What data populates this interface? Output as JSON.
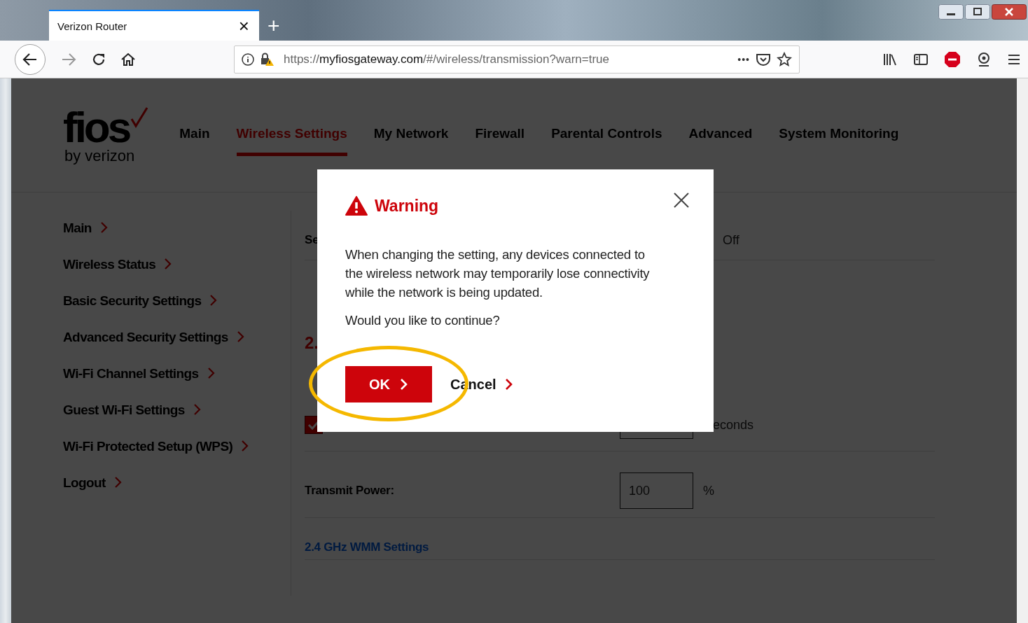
{
  "browser": {
    "tab": {
      "title": "Verizon Router",
      "close": "×"
    },
    "new_tab": "+",
    "url": {
      "scheme": "https://",
      "domain": "myfiosgateway.com",
      "path": "/#/wireless/transmission?warn=true"
    },
    "page_actions": "•••"
  },
  "logo": {
    "wordmark": "fios",
    "tagline": "by verizon"
  },
  "nav": [
    {
      "label": "Main",
      "selected": false
    },
    {
      "label": "Wireless Settings",
      "selected": true
    },
    {
      "label": "My Network",
      "selected": false
    },
    {
      "label": "Firewall",
      "selected": false
    },
    {
      "label": "Parental Controls",
      "selected": false
    },
    {
      "label": "Advanced",
      "selected": false
    },
    {
      "label": "System Monitoring",
      "selected": false
    }
  ],
  "sidebar": {
    "items": [
      {
        "label": "Main"
      },
      {
        "label": "Wireless Status"
      },
      {
        "label": "Basic Security Settings"
      },
      {
        "label": "Advanced Security Settings"
      },
      {
        "label": "Wi-Fi Channel Settings"
      },
      {
        "label": "Guest Wi-Fi Settings"
      },
      {
        "label": "Wi-Fi Protected Setup (WPS)"
      },
      {
        "label": "Logout"
      }
    ]
  },
  "content": {
    "rows": [
      {
        "kind": "setting",
        "label": "Se",
        "value": "Off"
      },
      {
        "kind": "heading",
        "text": "2."
      },
      {
        "kind": "checkbox",
        "checked": true,
        "unit": "econds"
      },
      {
        "kind": "field",
        "label": "Transmit Power:",
        "value": "100",
        "unit": "%"
      },
      {
        "kind": "link",
        "text": "2.4 GHz WMM Settings"
      }
    ]
  },
  "dialog": {
    "title": "Warning",
    "message": "When changing the setting, any devices connected to the wireless network may temporarily lose connectivity while the network is being updated.",
    "question": "Would you like to continue?",
    "buttons": [
      {
        "label": "OK",
        "kind": "primary"
      },
      {
        "label": "Cancel",
        "kind": "link"
      }
    ]
  }
}
